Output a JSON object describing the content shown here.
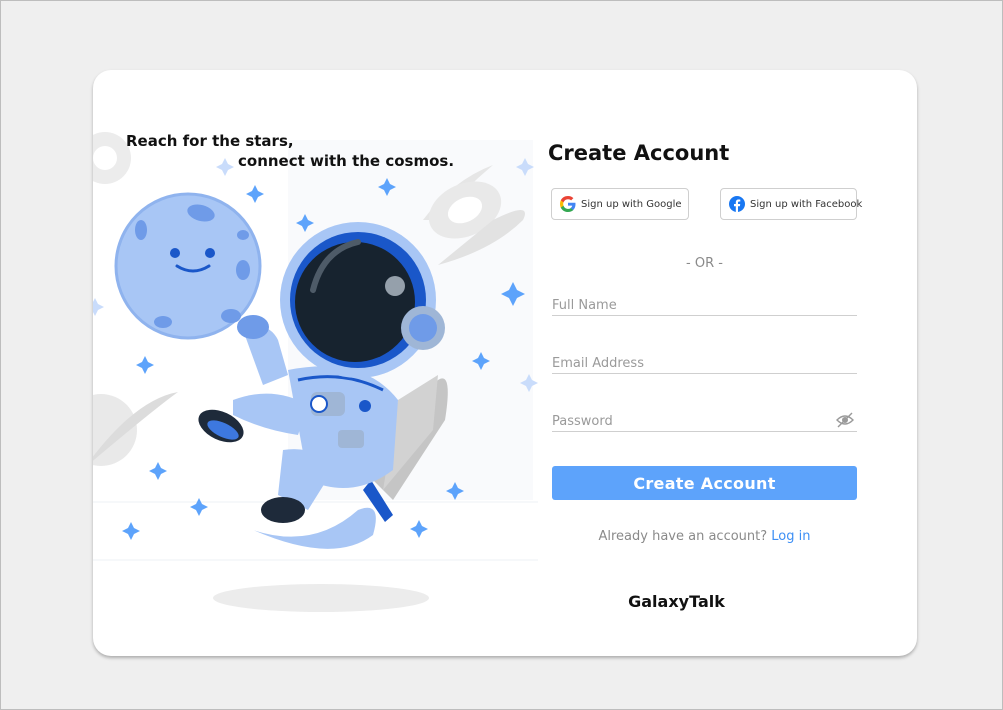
{
  "hero": {
    "tagline_line1": "Reach for the stars,",
    "tagline_line2": "connect with the cosmos.",
    "illustration": "astronaut-with-moon-and-rocket"
  },
  "form": {
    "title": "Create Account",
    "google_label": "Sign up with Google",
    "facebook_label": "Sign up with Facebook",
    "divider": "- OR -",
    "full_name_placeholder": "Full Name",
    "email_placeholder": "Email Address",
    "password_placeholder": "Password",
    "password_icon": "eye-slash-icon",
    "submit_label": "Create Account",
    "login_prompt": "Already have an account?",
    "login_link": "Log in"
  },
  "brand": {
    "name": "GalaxyTalk"
  },
  "colors": {
    "accent": "#5da3fb",
    "link": "#3d8ff5",
    "background": "#efefef",
    "card": "#ffffff",
    "facebook": "#1877f2"
  }
}
